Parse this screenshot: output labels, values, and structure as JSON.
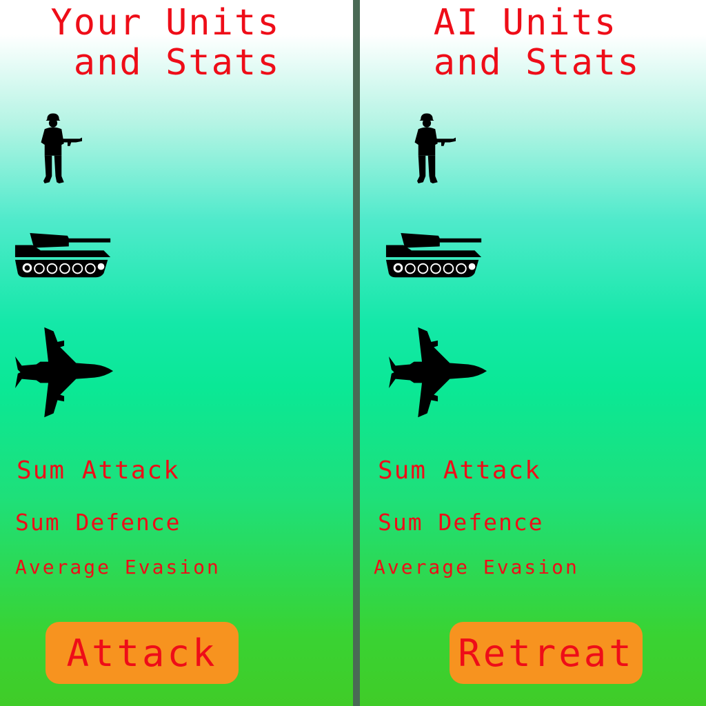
{
  "player": {
    "title": "Your Units\n and Stats",
    "units": [
      {
        "icon": "soldier-icon"
      },
      {
        "icon": "tank-icon"
      },
      {
        "icon": "jet-icon"
      }
    ],
    "stats": {
      "sum_attack": "Sum Attack",
      "sum_defence": "Sum Defence",
      "average_evasion": "Average Evasion"
    },
    "action_label": "Attack"
  },
  "ai": {
    "title": "AI Units\n and Stats",
    "units": [
      {
        "icon": "soldier-icon"
      },
      {
        "icon": "tank-icon"
      },
      {
        "icon": "jet-icon"
      }
    ],
    "stats": {
      "sum_attack": "Sum Attack",
      "sum_defence": "Sum Defence",
      "average_evasion": "Average Evasion"
    },
    "action_label": "Retreat"
  },
  "colors": {
    "text_red": "#ee0d18",
    "button_orange": "#f7931f",
    "divider": "#4a6a55",
    "icon_black": "#000000"
  }
}
